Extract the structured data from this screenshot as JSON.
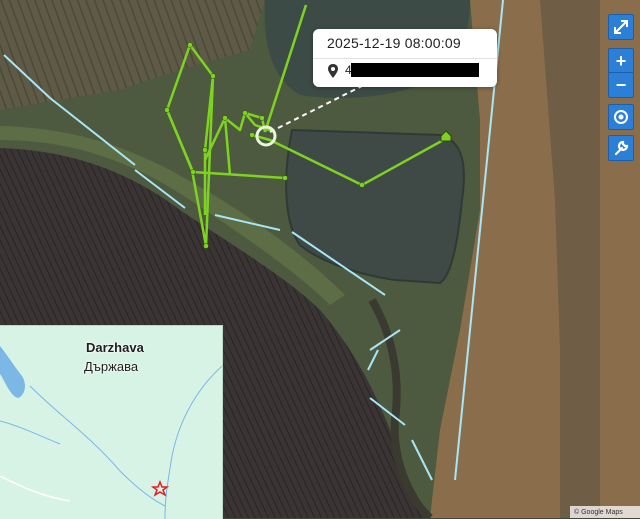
{
  "tooltip": {
    "timestamp": "2025-12-19 08:00:09",
    "address_prefix": "4",
    "address_redacted": true
  },
  "controls": [
    {
      "name": "fullscreen-button",
      "icon": "expand-icon"
    },
    {
      "name": "zoom-in-button",
      "label": "+",
      "icon": "plus-icon"
    },
    {
      "name": "zoom-out-button",
      "label": "−",
      "icon": "minus-icon"
    },
    {
      "name": "locate-button",
      "icon": "target-icon"
    },
    {
      "name": "settings-button",
      "icon": "wrench-icon"
    }
  ],
  "inset_map": {
    "place_name_en": "Darzhava",
    "place_name_bg": "Държава",
    "marker": "red-star-icon"
  },
  "attribution": "© Google Maps",
  "colors": {
    "track": "#7ed321",
    "boundary_line": "#a8e6f5",
    "control_bg": "#2c7fd6",
    "inset_bg": "#d7f3e6",
    "home_marker": "#7ed321"
  }
}
